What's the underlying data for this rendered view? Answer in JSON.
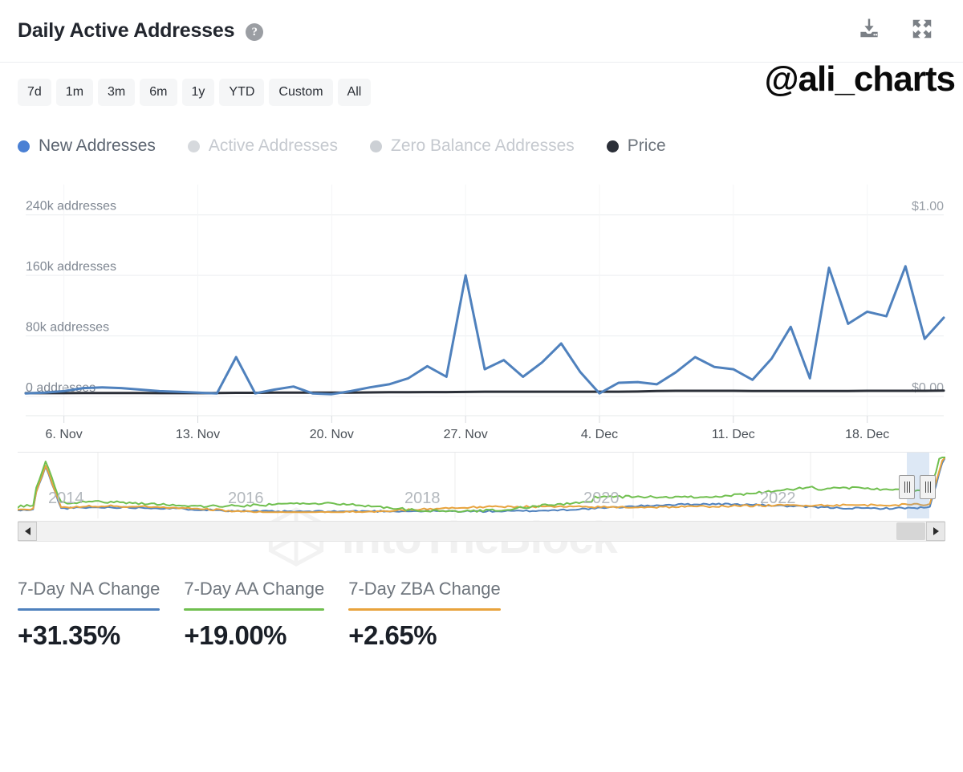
{
  "header": {
    "title": "Daily Active Addresses",
    "help_icon": "question-circle-icon",
    "download_icon": "download-icon",
    "expand_icon": "expand-icon"
  },
  "toolbar": {
    "ranges": [
      {
        "label": "7d"
      },
      {
        "label": "1m"
      },
      {
        "label": "3m"
      },
      {
        "label": "6m"
      },
      {
        "label": "1y"
      },
      {
        "label": "YTD"
      },
      {
        "label": "Custom"
      },
      {
        "label": "All"
      }
    ],
    "watermark_handle": "@ali_charts"
  },
  "legend": [
    {
      "label": "New Addresses",
      "color": "#4a80d4",
      "text_color": "#5b6470",
      "active": true
    },
    {
      "label": "Active Addresses",
      "color": "#d6d9dd",
      "text_color": "#c5c9cf",
      "active": false
    },
    {
      "label": "Zero Balance Addresses",
      "color": "#ccd0d5",
      "text_color": "#c5c9cf",
      "active": false
    },
    {
      "label": "Price",
      "color": "#2b2f38",
      "text_color": "#6e757d",
      "active": true
    }
  ],
  "watermark": {
    "brand": "IntoTheBlock",
    "logo_icon": "intotheblock-cube-icon"
  },
  "navigator": {
    "years": [
      "2014",
      "2016",
      "2018",
      "2020",
      "2022"
    ],
    "series_colors": {
      "new": "#4F81BD",
      "active": "#70BF4F",
      "zero": "#E8A33D"
    },
    "scroll_left_icon": "arrow-left-icon",
    "scroll_right_icon": "arrow-right-icon"
  },
  "stats": [
    {
      "label": "7-Day NA Change",
      "value": "+31.35%",
      "color": "#4F81BD"
    },
    {
      "label": "7-Day AA Change",
      "value": "+19.00%",
      "color": "#70BF4F"
    },
    {
      "label": "7-Day ZBA Change",
      "value": "+2.65%",
      "color": "#E8A33D"
    }
  ],
  "chart_data": {
    "type": "line",
    "title": "Daily Active Addresses",
    "xlabel": "",
    "ylabel": "addresses",
    "y2label": "price",
    "ylim": [
      0,
      280000
    ],
    "y2lim": [
      0,
      1.17
    ],
    "grid": true,
    "legend_position": "top-left",
    "y_ticks": [
      {
        "value": 240000,
        "label": "240k addresses"
      },
      {
        "value": 160000,
        "label": "160k addresses"
      },
      {
        "value": 80000,
        "label": "80k addresses"
      },
      {
        "value": 0,
        "label": "0 addresses"
      }
    ],
    "y2_ticks": [
      {
        "value": 1.0,
        "label": "$1.00"
      },
      {
        "value": 0.0,
        "label": "$0.00"
      }
    ],
    "x_ticks": [
      "6. Nov",
      "13. Nov",
      "20. Nov",
      "27. Nov",
      "4. Dec",
      "11. Dec",
      "18. Dec"
    ],
    "x": [
      "4. Nov",
      "5. Nov",
      "6. Nov",
      "7. Nov",
      "8. Nov",
      "9. Nov",
      "10. Nov",
      "11. Nov",
      "12. Nov",
      "13. Nov",
      "14. Nov",
      "15. Nov",
      "16. Nov",
      "17. Nov",
      "18. Nov",
      "19. Nov",
      "20. Nov",
      "21. Nov",
      "22. Nov",
      "23. Nov",
      "24. Nov",
      "25. Nov",
      "26. Nov",
      "27. Nov",
      "28. Nov",
      "29. Nov",
      "30. Nov",
      "1. Dec",
      "2. Dec",
      "3. Dec",
      "4. Dec",
      "5. Dec",
      "6. Dec",
      "7. Dec",
      "8. Dec",
      "9. Dec",
      "10. Dec",
      "11. Dec",
      "12. Dec",
      "13. Dec",
      "14. Dec",
      "15. Dec",
      "16. Dec",
      "17. Dec",
      "18. Dec",
      "19. Dec",
      "20. Dec",
      "21. Dec",
      "22. Dec"
    ],
    "series": [
      {
        "name": "New Addresses",
        "color": "#4F81BD",
        "axis": "left",
        "unit": "addresses",
        "values": [
          4000,
          5000,
          7000,
          11000,
          12000,
          11000,
          9000,
          7000,
          6000,
          5000,
          4000,
          52000,
          4000,
          9000,
          13000,
          4000,
          3000,
          7000,
          12000,
          16000,
          24000,
          40000,
          26000,
          160000,
          36000,
          48000,
          26000,
          45000,
          70000,
          32000,
          4000,
          18000,
          19000,
          16000,
          32000,
          52000,
          39000,
          36000,
          22000,
          50000,
          92000,
          24000,
          170000,
          96000,
          112000,
          106000,
          172000,
          76000,
          104000
        ]
      },
      {
        "name": "Price",
        "color": "#2b2f38",
        "axis": "right",
        "unit": "USD",
        "values": [
          0.018,
          0.018,
          0.018,
          0.019,
          0.019,
          0.019,
          0.019,
          0.018,
          0.018,
          0.018,
          0.019,
          0.02,
          0.02,
          0.021,
          0.021,
          0.021,
          0.021,
          0.021,
          0.022,
          0.023,
          0.023,
          0.024,
          0.024,
          0.025,
          0.026,
          0.026,
          0.026,
          0.026,
          0.026,
          0.026,
          0.026,
          0.026,
          0.027,
          0.03,
          0.031,
          0.031,
          0.031,
          0.031,
          0.03,
          0.03,
          0.03,
          0.03,
          0.03,
          0.03,
          0.031,
          0.031,
          0.031,
          0.031,
          0.032
        ]
      }
    ]
  }
}
